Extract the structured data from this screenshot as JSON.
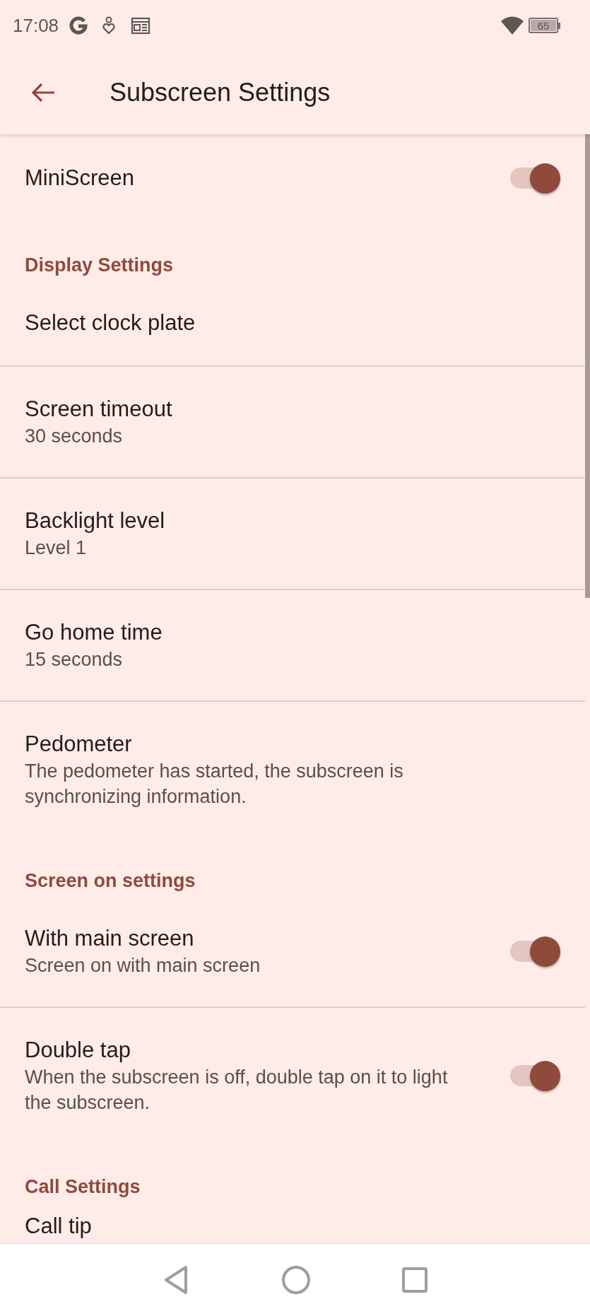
{
  "status_bar": {
    "time": "17:08",
    "battery": "65"
  },
  "app_bar": {
    "title": "Subscreen Settings"
  },
  "items": [
    {
      "kind": "switch",
      "title": "MiniScreen",
      "on": true
    },
    {
      "kind": "header",
      "title": "Display Settings"
    },
    {
      "kind": "item",
      "title": "Select clock plate"
    },
    {
      "kind": "item",
      "title": "Screen timeout",
      "subtitle": "30 seconds"
    },
    {
      "kind": "item",
      "title": "Backlight level",
      "subtitle": "Level 1"
    },
    {
      "kind": "item",
      "title": "Go home time",
      "subtitle": "15 seconds"
    },
    {
      "kind": "item",
      "title": "Pedometer",
      "subtitle": "The pedometer has started, the subscreen is synchronizing information."
    },
    {
      "kind": "header",
      "title": "Screen on settings"
    },
    {
      "kind": "switch",
      "title": "With main screen",
      "subtitle": "Screen on with main screen",
      "on": true
    },
    {
      "kind": "switch",
      "title": "Double tap",
      "subtitle": "When the subscreen is off, double tap on it to light the subscreen.",
      "on": true
    },
    {
      "kind": "header",
      "title": "Call Settings"
    },
    {
      "kind": "item",
      "title": "Call tip"
    }
  ]
}
